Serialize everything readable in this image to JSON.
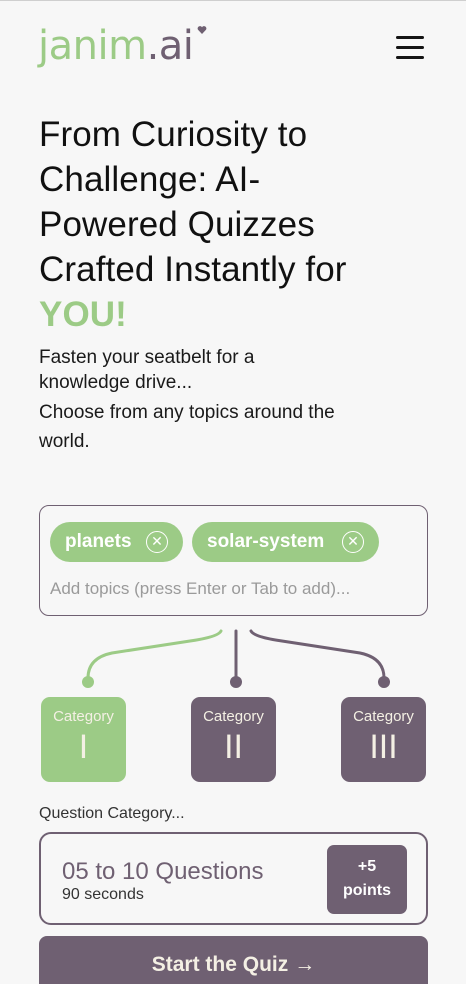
{
  "header": {
    "logo_part1": "janim",
    "logo_part2": ".ai",
    "menu_icon": "hamburger-menu-icon"
  },
  "hero": {
    "title": "From Curiosity to Challenge: AI-Powered Quizzes Crafted Instantly for",
    "title_accent": "YOU!",
    "subtitle_line1": "Fasten your seatbelt for a knowledge drive...",
    "subtitle_line2": "Choose from any topics around the world."
  },
  "topics": {
    "chips": [
      {
        "label": "planets",
        "remove_icon": "close-circle-icon"
      },
      {
        "label": "solar-system",
        "remove_icon": "close-circle-icon"
      }
    ],
    "input_value": "",
    "placeholder": "Add topics (press Enter or Tab to add)..."
  },
  "categories": [
    {
      "label": "Category",
      "numeral": "I",
      "selected": true
    },
    {
      "label": "Category",
      "numeral": "II",
      "selected": false
    },
    {
      "label": "Category",
      "numeral": "III",
      "selected": false
    }
  ],
  "question": {
    "caption": "Question Category...",
    "title": "05 to 10 Questions",
    "subtitle": "90 seconds",
    "points_line1": "+5",
    "points_line2": "points"
  },
  "start": {
    "label": "Start the Quiz",
    "arrow": "→"
  },
  "colors": {
    "accent_green": "#9ccb86",
    "brand_purple": "#6f6072",
    "background": "#f7f7f7"
  }
}
